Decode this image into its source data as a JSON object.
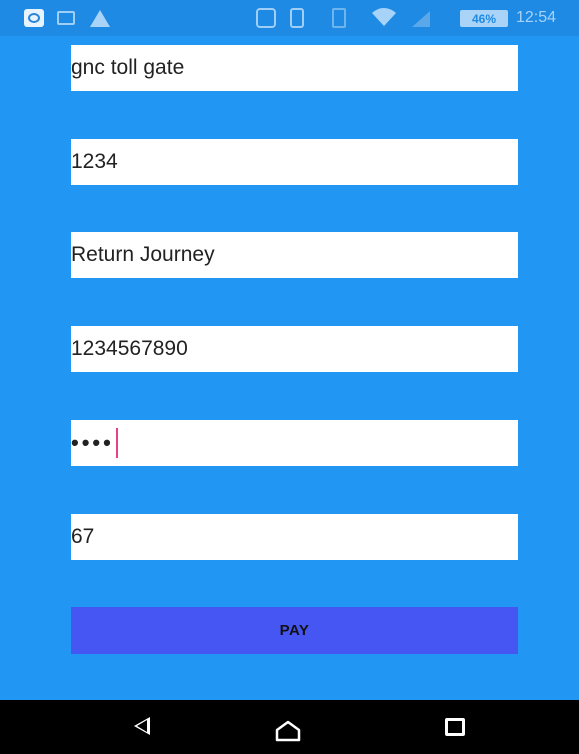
{
  "status_bar": {
    "icons": [
      "app-notification-icon",
      "image-notification-icon",
      "warning-icon",
      "nfc-icon",
      "vibrate-icon",
      "sim-icon",
      "wifi-icon",
      "signal-icon"
    ],
    "battery": "46%",
    "time": "12:54"
  },
  "form": {
    "field_1_value": "gnc toll gate",
    "field_2_value": "1234",
    "field_3_value": "Return Journey",
    "field_4_value": "1234567890",
    "field_5_masked": "••••",
    "field_6_value": "67",
    "pay_label": "PAY"
  },
  "nav_bar": {
    "icons": [
      "back-icon",
      "home-icon",
      "recents-icon"
    ]
  },
  "colors": {
    "background": "#2196f3",
    "pay_button": "#4656f2",
    "cursor": "#e83e8c",
    "nav_bar": "#000000"
  }
}
